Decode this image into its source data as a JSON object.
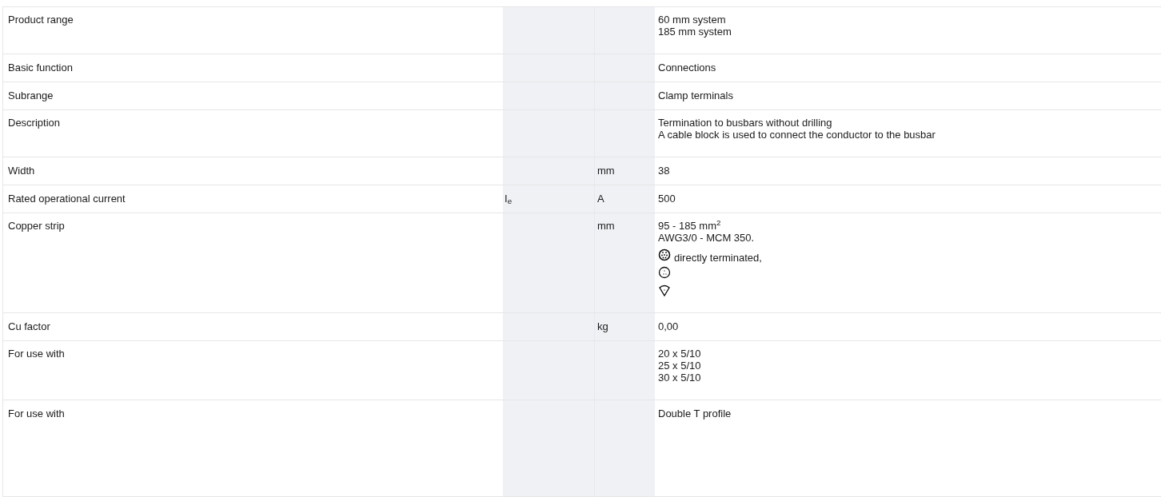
{
  "rows": [
    {
      "label": "Product range",
      "symbol": "",
      "unit": "",
      "value": [
        {
          "kind": "text",
          "text": "60 mm system"
        },
        {
          "kind": "text",
          "text": "185 mm system"
        }
      ]
    },
    {
      "label": "Basic function",
      "symbol": "",
      "unit": "",
      "value": [
        {
          "kind": "text",
          "text": "Connections"
        }
      ]
    },
    {
      "label": "Subrange",
      "symbol": "",
      "unit": "",
      "value": [
        {
          "kind": "text",
          "text": "Clamp terminals"
        }
      ]
    },
    {
      "label": "Description",
      "symbol": "",
      "unit": "",
      "value": [
        {
          "kind": "text",
          "text": "Termination to busbars without drilling"
        },
        {
          "kind": "text",
          "text": "A cable block is used to connect the conductor to the busbar"
        }
      ]
    },
    {
      "label": "Width",
      "symbol": "",
      "unit": "mm",
      "value": [
        {
          "kind": "text",
          "text": "38"
        }
      ]
    },
    {
      "label": "Rated operational current",
      "symbol": "I$_{e}$",
      "unit": "A",
      "value": [
        {
          "kind": "text",
          "text": "500"
        }
      ]
    },
    {
      "label": "Copper strip",
      "symbol": "",
      "unit": "mm",
      "value": [
        {
          "kind": "text",
          "text": "95 - 185 mm$^{2}$"
        },
        {
          "kind": "text",
          "text": "AWG3/0 - MCM 350."
        },
        {
          "kind": "multidot",
          "text": "directly terminated,"
        },
        {
          "kind": "tridot"
        },
        {
          "kind": "sector"
        }
      ]
    },
    {
      "label": "Cu factor",
      "symbol": "",
      "unit": "kg",
      "value": [
        {
          "kind": "text",
          "text": "0,00"
        }
      ]
    },
    {
      "label": "For use with",
      "symbol": "",
      "unit": "",
      "value": [
        {
          "kind": "text",
          "text": "20 x 5/10"
        },
        {
          "kind": "text",
          "text": "25 x 5/10"
        },
        {
          "kind": "text",
          "text": "30 x 5/10"
        }
      ]
    },
    {
      "label": "For use with",
      "symbol": "",
      "unit": "",
      "value": [
        {
          "kind": "text",
          "text": "Double T profile"
        }
      ]
    }
  ]
}
